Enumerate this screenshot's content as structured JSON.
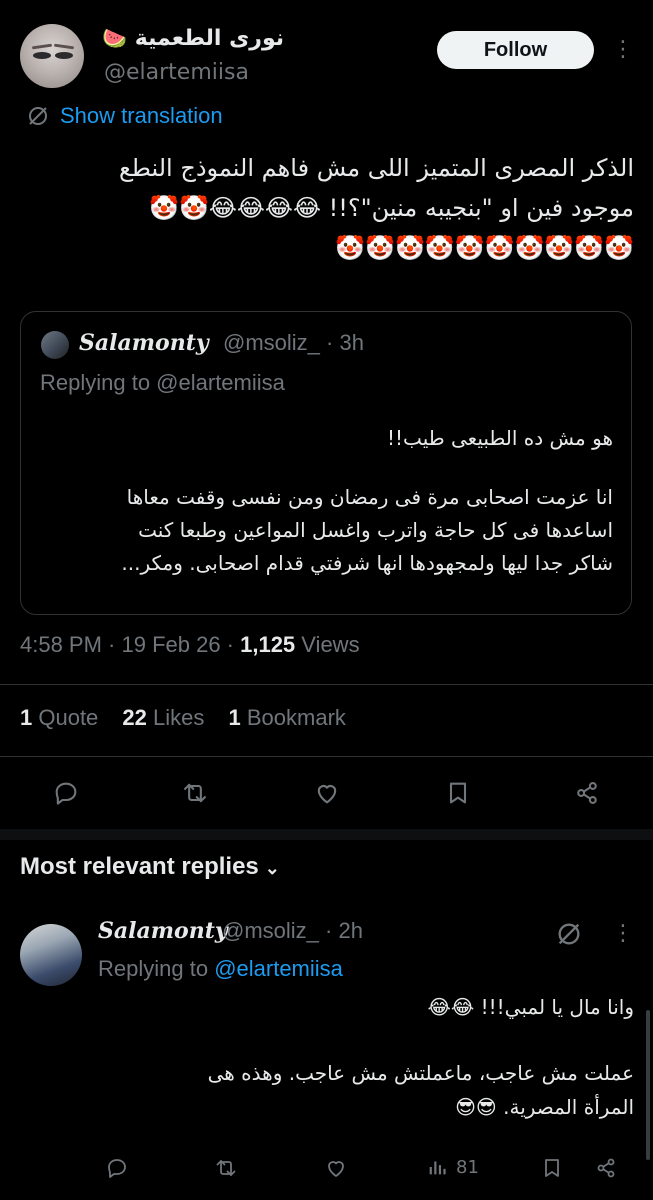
{
  "author": {
    "display_name": "نورى الطعمية",
    "name_emoji": "🍉",
    "handle": "@elartemiisa"
  },
  "follow_label": "Follow",
  "more_label": "⋮",
  "show_translation": "Show translation",
  "tweet": {
    "lines": [
      "الذكر المصرى المتميز اللى مش فاهم النموذج النطع",
      "موجود فين او \"بنجيبه منين\"؟!! 😂😂😂😂🤡🤡",
      "🤡🤡🤡🤡🤡🤡🤡🤡🤡🤡"
    ]
  },
  "quoted": {
    "name": "Salamonty",
    "handle_time": "@msoliz_ · 3h",
    "replying_to": "Replying to @elartemiisa",
    "line1": "هو مش ده الطبيعى طيب!!",
    "line2": "انا عزمت اصحابى مرة فى رمضان ومن نفسى وقفت معاها",
    "line3": "اساعدها فى كل حاجة واترب واغسل المواعين وطبعا كنت",
    "line4": "شاكر جدا ليها ولمجهودها انها شرفتي قدام اصحابى. ومكر..."
  },
  "meta": {
    "time_date": "4:58 PM · 19 Feb 26 · ",
    "views_count": "1,125",
    "views_label": " Views"
  },
  "stats": {
    "quotes_count": "1",
    "quotes_label": " Quote",
    "likes_count": "22",
    "likes_label": " Likes",
    "bookmarks_count": "1",
    "bookmarks_label": " Bookmark"
  },
  "replies_section": {
    "title": "Most relevant replies",
    "chevron": "⌄"
  },
  "reply": {
    "name": "Salamonty",
    "handle_time": "@msoliz_ · 2h",
    "replying_prefix": "Replying to ",
    "replying_mention": "@elartemiisa",
    "line1": "وانا مال يا لمبي!!! 😂😂",
    "line2": "عملت مش عاجب، ماعملتش مش عاجب. وهذه هى",
    "line3": "المرأة المصرية. 😎😎",
    "views": "81",
    "more_label": "⋮"
  },
  "colors": {
    "background": "#000000",
    "text": "#e7e9ea",
    "secondary": "#71767b",
    "accent": "#1d9bf0",
    "divider": "#2f3336"
  },
  "icons": [
    "translate-icon",
    "reply-icon",
    "retweet-icon",
    "like-icon",
    "bookmark-icon",
    "share-icon",
    "views-icon",
    "more-icon",
    "chevron-down-icon"
  ]
}
